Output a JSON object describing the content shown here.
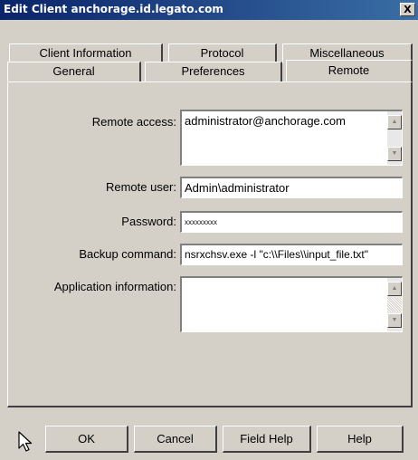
{
  "window": {
    "title": "Edit Client anchorage.id.legato.com",
    "close_glyph": "X"
  },
  "tabs": {
    "row1": [
      "Client Information",
      "Protocol",
      "Miscellaneous"
    ],
    "row2": [
      "General",
      "Preferences",
      "Remote"
    ],
    "active": "Remote"
  },
  "form": {
    "remote_access_label": "Remote access:",
    "remote_access_value": "administrator@anchorage.com",
    "remote_user_label": "Remote user:",
    "remote_user_value": "Admin\\administrator",
    "password_label": "Password:",
    "password_value": "xxxxxxxxx",
    "backup_command_label": "Backup command:",
    "backup_command_value": "nsrxchsv.exe -l \"c:\\\\Files\\\\input_file.txt\"",
    "app_info_label": "Application information:",
    "app_info_value": ""
  },
  "buttons": {
    "ok": "OK",
    "cancel": "Cancel",
    "field_help": "Field Help",
    "help": "Help"
  },
  "icons": {
    "cursor": "mouse-pointer-icon",
    "scroll_up": "scroll-up-arrow-icon",
    "scroll_down": "scroll-down-arrow-icon"
  },
  "colors": {
    "titlebar_start": "#0a246a",
    "titlebar_end": "#3a6ea5",
    "dialog_face": "#d4d0c8"
  }
}
